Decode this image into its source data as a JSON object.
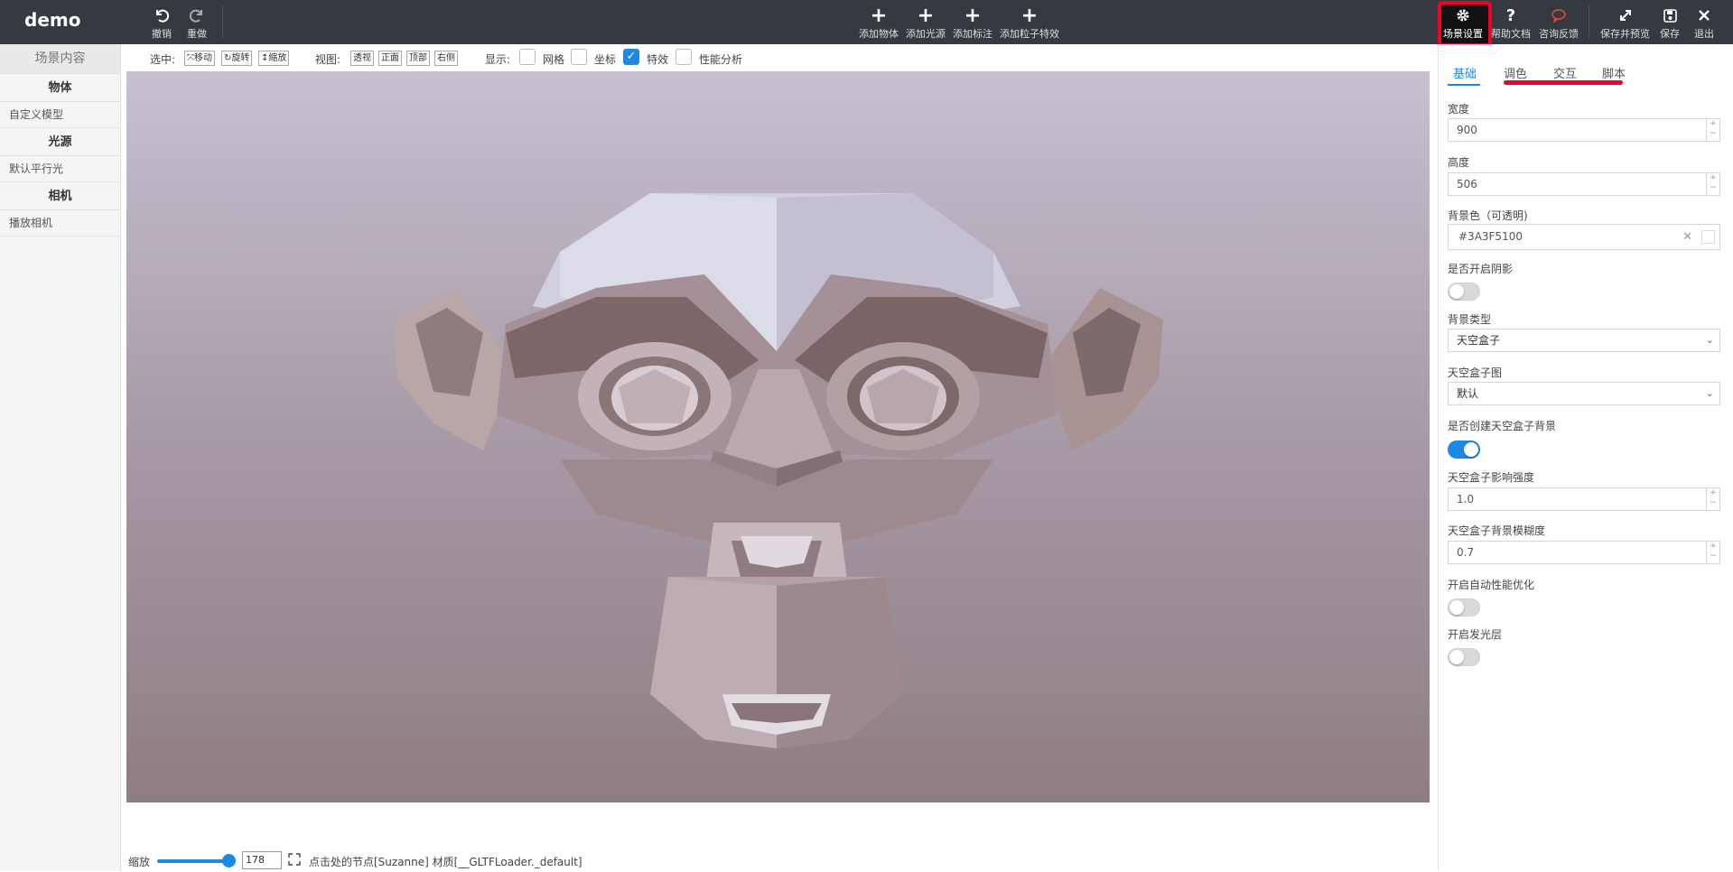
{
  "app": {
    "title": "demo"
  },
  "toolbar": {
    "undo": "撤销",
    "redo": "重做",
    "add_object": "添加物体",
    "add_light": "添加光源",
    "add_annotation": "添加标注",
    "add_particle": "添加粒子特效",
    "scene_settings": "场景设置",
    "help_docs": "帮助文档",
    "feedback": "咨询反馈",
    "save_preview": "保存并预览",
    "save": "保存",
    "exit": "退出"
  },
  "left_panel": {
    "header": "场景内容",
    "groups": [
      {
        "title": "物体",
        "items": [
          "自定义模型"
        ]
      },
      {
        "title": "光源",
        "items": [
          "默认平行光"
        ]
      },
      {
        "title": "相机",
        "items": [
          "播放相机"
        ]
      }
    ]
  },
  "viewbar": {
    "select_label": "选中:",
    "move": "移动",
    "rotate": "旋转",
    "scale": "缩放",
    "view_label": "视图:",
    "perspective": "透视",
    "front": "正面",
    "top": "顶部",
    "right": "右侧",
    "display_label": "显示:",
    "grid": "网格",
    "axes": "坐标",
    "effects": "特效",
    "perf": "性能分析"
  },
  "status": {
    "zoom_label": "缩放",
    "zoom_value": "178",
    "zoom_fraction": 0.89,
    "text": "点击处的节点[Suzanne] 材质[__GLTFLoader._default]"
  },
  "right_panel": {
    "tabs": [
      "基础",
      "调色",
      "交互",
      "脚本"
    ],
    "active_tab": "基础",
    "width_label": "宽度",
    "width_value": "900",
    "height_label": "高度",
    "height_value": "506",
    "bg_color_label": "背景色（可透明)",
    "bg_color_value": "#3A3F5100",
    "shadow_label": "是否开启阴影",
    "shadow_on": false,
    "bg_type_label": "背景类型",
    "bg_type_value": "天空盒子",
    "skybox_label": "天空盒子图",
    "skybox_value": "默认",
    "create_skybox_label": "是否创建天空盒子背景",
    "create_skybox_on": true,
    "skybox_intensity_label": "天空盒子影响强度",
    "skybox_intensity_value": "1.0",
    "skybox_blur_label": "天空盒子背景模糊度",
    "skybox_blur_value": "0.7",
    "auto_perf_label": "开启自动性能优化",
    "auto_perf_on": false,
    "glow_label": "开启发光层",
    "glow_on": false
  },
  "colors": {
    "topbar": "#343a40",
    "accent": "#1e88e5",
    "highlight": "#f0002a"
  }
}
